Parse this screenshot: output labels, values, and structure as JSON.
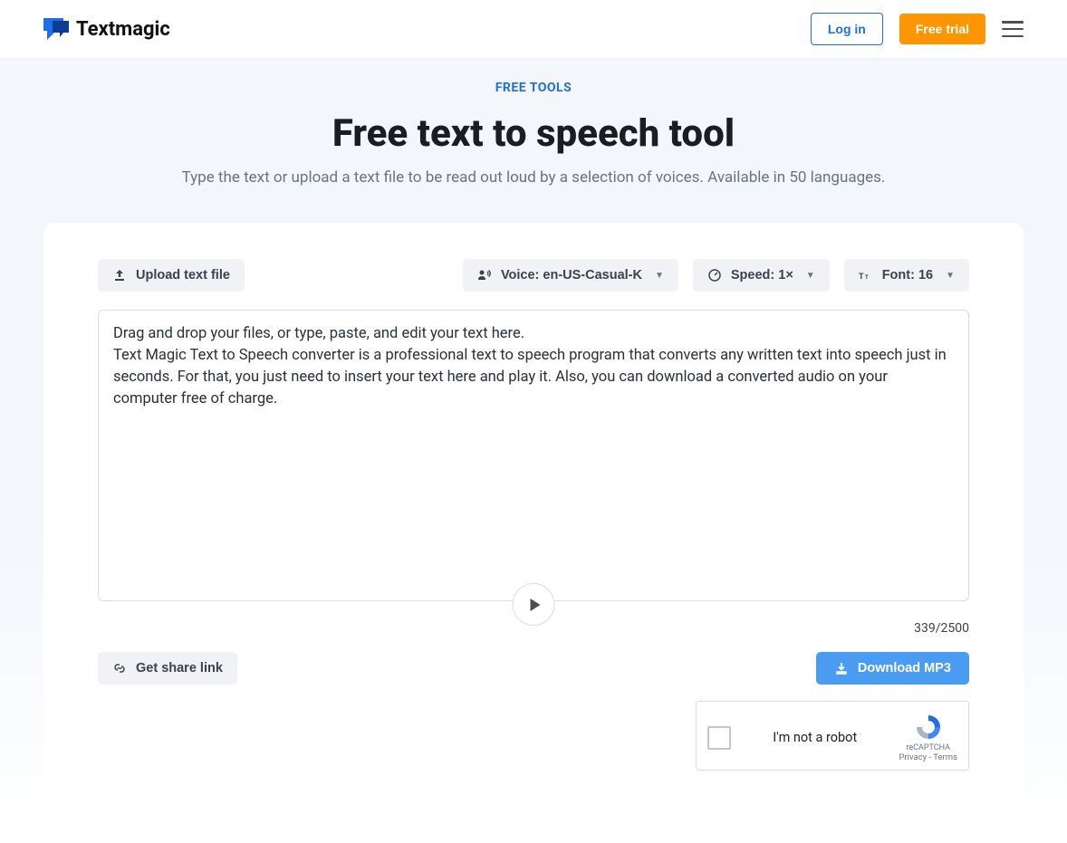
{
  "header": {
    "brand": "Textmagic",
    "login": "Log in",
    "trial": "Free trial"
  },
  "hero": {
    "eyebrow": "FREE TOOLS",
    "title": "Free text to speech tool",
    "subtitle": "Type the text or upload a text file to be read out loud by a selection of voices. Available in 50 languages."
  },
  "toolbar": {
    "upload": "Upload text file",
    "voice_label": "Voice: en-US-Casual-K",
    "speed_label": "Speed: 1×",
    "font_label": "Font: 16"
  },
  "editor": {
    "content": "Drag and drop your files, or type, paste, and edit your text here.\nText Magic Text to Speech converter is a professional text to speech program that converts any written text into speech just in seconds. For that, you just need to insert your text here and play it. Also, you can download a converted audio on your computer free of charge.",
    "counter": "339/2500"
  },
  "actions": {
    "share": "Get share link",
    "download": "Download MP3"
  },
  "recaptcha": {
    "text": "I'm not a robot",
    "brand": "reCAPTCHA",
    "privacy": "Privacy",
    "terms": "Terms"
  }
}
